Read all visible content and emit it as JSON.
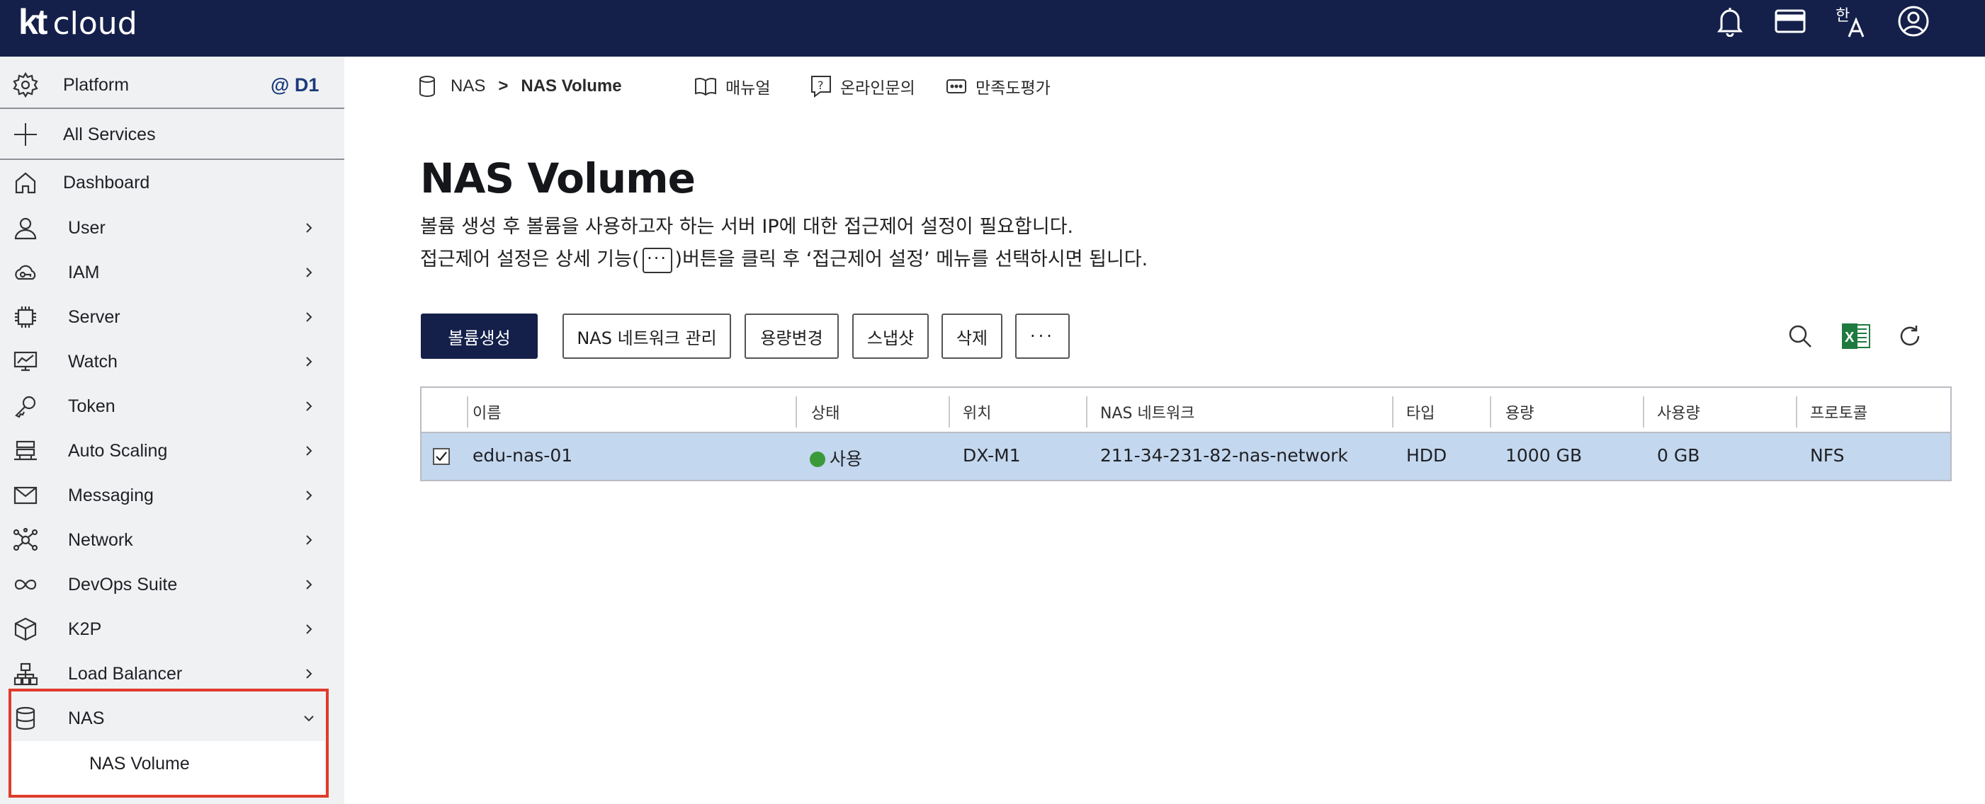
{
  "app": {
    "logo_kt": "kt",
    "logo_cloud": "cloud",
    "top_icons": [
      "bell-icon",
      "credit-card-icon",
      "language-icon",
      "user-account-icon"
    ]
  },
  "sidebar": {
    "platform": {
      "label": "Platform",
      "badge": "@ D1",
      "icon": "gear-icon"
    },
    "all_services": {
      "label": "All Services",
      "icon": "plus-icon"
    },
    "dashboard": {
      "label": "Dashboard",
      "icon": "home-icon"
    },
    "items": [
      {
        "label": "User",
        "icon": "user-icon"
      },
      {
        "label": "IAM",
        "icon": "cloud-key-icon"
      },
      {
        "label": "Server",
        "icon": "chip-icon"
      },
      {
        "label": "Watch",
        "icon": "monitor-chart-icon"
      },
      {
        "label": "Token",
        "icon": "key-icon"
      },
      {
        "label": "Auto Scaling",
        "icon": "server-stack-icon"
      },
      {
        "label": "Messaging",
        "icon": "envelope-icon"
      },
      {
        "label": "Network",
        "icon": "network-icon"
      },
      {
        "label": "DevOps Suite",
        "icon": "infinity-icon"
      },
      {
        "label": "K2P",
        "icon": "cube-icon"
      },
      {
        "label": "Load Balancer",
        "icon": "load-balancer-icon"
      },
      {
        "label": "NAS",
        "icon": "database-icon",
        "expanded": true
      }
    ],
    "nas_sub_item": "NAS Volume",
    "highlight_color": "#e03b2b"
  },
  "breadcrumb": {
    "root": "NAS",
    "separator": ">",
    "current": "NAS Volume"
  },
  "help_links": {
    "manual": "매뉴얼",
    "inquiry": "온라인문의",
    "survey": "만족도평가"
  },
  "page": {
    "title": "NAS Volume",
    "desc_line1": "볼륨 생성 후 볼륨을 사용하고자 하는 서버 IP에 대한 접근제어 설정이 필요합니다.",
    "desc_line2_a": "접근제어 설정은 상세 기능(",
    "desc_line2_dots": "···",
    "desc_line2_b": ")버튼을 클릭 후 ‘접근제어 설정’ 메뉴를 선택하시면 됩니다."
  },
  "toolbar": {
    "create": "볼륨생성",
    "nas_network": "NAS 네트워크 관리",
    "resize": "용량변경",
    "snapshot": "스냅샷",
    "delete": "삭제",
    "more": "···",
    "tool_icons": [
      "search-icon",
      "excel-icon",
      "refresh-icon"
    ]
  },
  "table": {
    "headers": {
      "name": "이름",
      "status": "상태",
      "location": "위치",
      "nas_network": "NAS 네트워크",
      "type": "타입",
      "capacity": "용량",
      "usage": "사용량",
      "protocol": "프로토콜"
    },
    "rows": [
      {
        "checked": true,
        "name": "edu-nas-01",
        "status": "사용",
        "status_color": "#3a9a3a",
        "location": "DX-M1",
        "nas_network": "211-34-231-82-nas-network",
        "type": "HDD",
        "capacity": "1000 GB",
        "usage": "0 GB",
        "protocol": "NFS"
      }
    ],
    "selected_row_color": "#c3d7ee"
  },
  "colors": {
    "topbar": "#14204a",
    "sidebar_bg": "#f0f1f3",
    "primary_button": "#14204a",
    "d1_badge": "#1c3a7a"
  }
}
